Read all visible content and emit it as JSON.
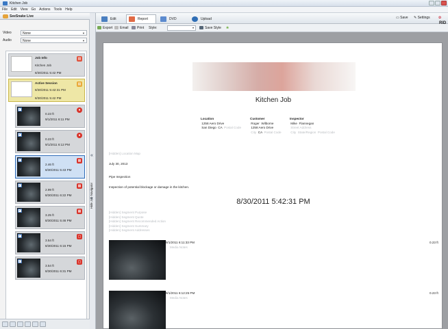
{
  "window": {
    "title": "Kitchen Job"
  },
  "menu": [
    "File",
    "Edit",
    "View",
    "Go",
    "Actions",
    "Tools",
    "Help"
  ],
  "left_panel": {
    "title": "SeeSnake Live",
    "video_label": "Video",
    "video_value": "None",
    "audio_label": "Audio",
    "audio_value": "None",
    "job_card": {
      "title": "Job Info",
      "name": "Kitchen Job",
      "date": "8/30/2011 5:42 PM"
    },
    "session_card": {
      "title": "Active Session",
      "started": "8/30/2011 5:42:31 PM",
      "date": "8/30/2011 5:42 PM"
    },
    "segments": [
      {
        "distance": "0.23 ft",
        "time": "9/1/2011 6:11 PM"
      },
      {
        "distance": "0.23 ft",
        "time": "9/1/2011 6:12 PM"
      },
      {
        "distance": "2.46 ft",
        "time": "8/30/2011 5:43 PM"
      },
      {
        "distance": "2.99 ft",
        "time": "8/30/2011 6:22 PM"
      },
      {
        "distance": "3.25 ft",
        "time": "8/30/2011 5:46 PM"
      },
      {
        "distance": "3.54 ft",
        "time": "8/30/2011 6:15 PM"
      },
      {
        "distance": "3.54 ft",
        "time": "8/30/2011 6:31 PM"
      }
    ]
  },
  "navigator": {
    "label": "Hide Job Navigator"
  },
  "tabs": [
    "Edit",
    "Report",
    "DVD",
    "Upload"
  ],
  "top_right": {
    "save": "Save",
    "settings": "Settings",
    "brand": "RID"
  },
  "toolbar": {
    "export": "Export",
    "email": "Email",
    "print": "Print",
    "style_label": "Style:",
    "save_style": "Save Style"
  },
  "report": {
    "title": "Kitchen Job",
    "location": {
      "header": "Location",
      "line1": "1258 Aero Drive",
      "city": "San Diego",
      "state": "CA",
      "postal": "Postal Code"
    },
    "customer": {
      "header": "Customer",
      "first": "Roger",
      "last": "Wilborne",
      "street": "1258 Aero Drive",
      "city": "City",
      "state": "CA",
      "postal": "Postal Code"
    },
    "inspector": {
      "header": "Inspector",
      "first": "Mike",
      "last": "Flannegan",
      "street": "Street Address",
      "city": "City",
      "state": "State/Region",
      "postal": "Postal Code"
    },
    "hidden_map": "[Hidden] Location Map",
    "date": "July 30, 2013",
    "type": "Pipe Inspection",
    "description": "Inspection of potential blockage or damage in the kitchen.",
    "session_time": "8/30/2011 5:42:31 PM",
    "hidden_fields": [
      "[Hidden] Segment Purpose",
      "[Hidden] Segment Quote",
      "[Hidden] Segment Recommended Action",
      "[Hidden] Segment Summary",
      "[Hidden] Segment Addresses"
    ],
    "entries": [
      {
        "time": "9/1/2011 6:11:33 PM",
        "notes": "Media Notes",
        "distance": "0.23 ft"
      },
      {
        "time": "9/1/2011 6:12:25 PM",
        "notes": "Media Notes",
        "distance": "0.23 ft"
      }
    ]
  }
}
